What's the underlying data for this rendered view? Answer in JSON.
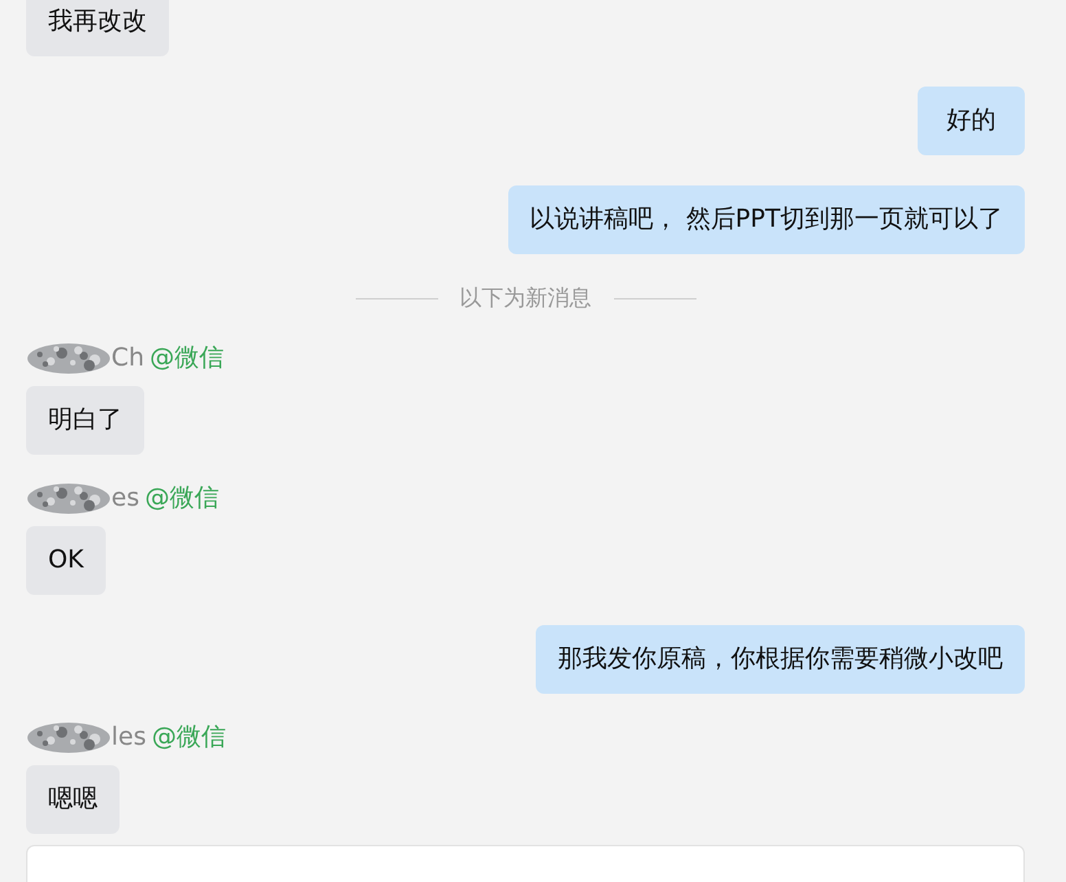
{
  "messages": [
    {
      "kind": "incoming",
      "text": "我再改改"
    },
    {
      "kind": "outgoing",
      "text": "好的"
    },
    {
      "kind": "outgoing",
      "text": "以说讲稿吧， 然后PPT切到那一页就可以了"
    },
    {
      "kind": "divider",
      "text": "以下为新消息"
    },
    {
      "kind": "incoming",
      "sender": "Ch",
      "source": "@微信",
      "text": "明白了"
    },
    {
      "kind": "incoming",
      "sender": "es",
      "source": "@微信",
      "text": "OK"
    },
    {
      "kind": "outgoing",
      "text": "那我发你原稿，你根据你需要稍微小改吧"
    },
    {
      "kind": "incoming",
      "sender": "les",
      "source": "@微信",
      "text": "嗯嗯"
    }
  ],
  "composer": {
    "kind": "field"
  }
}
